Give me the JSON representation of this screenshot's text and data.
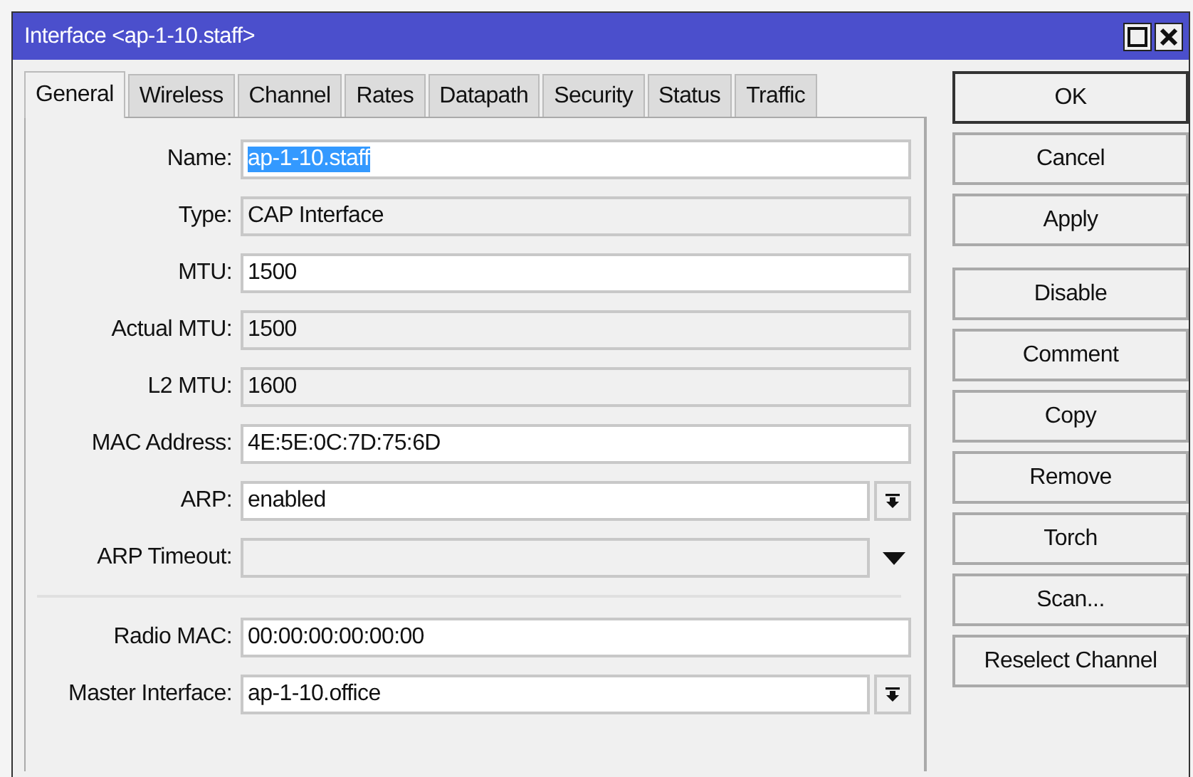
{
  "window": {
    "title": "Interface <ap-1-10.staff>"
  },
  "tabs": [
    {
      "label": "General",
      "selected": true
    },
    {
      "label": "Wireless",
      "selected": false
    },
    {
      "label": "Channel",
      "selected": false
    },
    {
      "label": "Rates",
      "selected": false
    },
    {
      "label": "Datapath",
      "selected": false
    },
    {
      "label": "Security",
      "selected": false
    },
    {
      "label": "Status",
      "selected": false
    },
    {
      "label": "Traffic",
      "selected": false
    }
  ],
  "sections": [
    [
      {
        "label": "Name:",
        "value": "ap-1-10.staff",
        "kind": "text",
        "highlighted": true
      },
      {
        "label": "Type:",
        "value": "CAP Interface",
        "kind": "readonly"
      },
      {
        "label": "MTU:",
        "value": "1500",
        "kind": "text"
      },
      {
        "label": "Actual MTU:",
        "value": "1500",
        "kind": "readonly"
      },
      {
        "label": "L2 MTU:",
        "value": "1600",
        "kind": "readonly"
      },
      {
        "label": "MAC Address:",
        "value": "4E:5E:0C:7D:75:6D",
        "kind": "text"
      },
      {
        "label": "ARP:",
        "value": "enabled",
        "kind": "combo"
      },
      {
        "label": "ARP Timeout:",
        "kind": "optional"
      }
    ],
    [
      {
        "label": "Radio MAC:",
        "value": "00:00:00:00:00:00",
        "kind": "text"
      },
      {
        "label": "Master Interface:",
        "value": "ap-1-10.office",
        "kind": "combo"
      }
    ]
  ],
  "button_groups": [
    [
      {
        "label": "OK",
        "default": true
      },
      {
        "label": "Cancel",
        "default": false
      },
      {
        "label": "Apply",
        "default": false
      }
    ],
    [
      {
        "label": "Disable",
        "default": false
      },
      {
        "label": "Comment",
        "default": false
      },
      {
        "label": "Copy",
        "default": false
      },
      {
        "label": "Remove",
        "default": false
      },
      {
        "label": "Torch",
        "default": false
      },
      {
        "label": "Scan...",
        "default": false
      },
      {
        "label": "Reselect Channel",
        "default": false
      }
    ]
  ]
}
